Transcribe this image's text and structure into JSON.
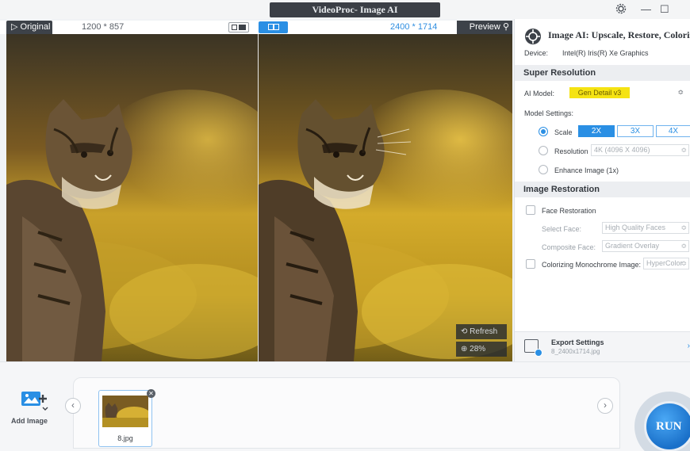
{
  "window": {
    "title": "VideoProc- Image AI",
    "settings_icon": "gear-icon",
    "minimize": "—",
    "maximize": "☐"
  },
  "preview_header": {
    "original_tab": "▷ Original",
    "original_resolution": "1200 * 857",
    "output_resolution": "2400 * 1714",
    "preview_tab": "Preview",
    "refresh_label": "Refresh",
    "zoom_label": "28%"
  },
  "panel": {
    "title": "Image AI: Upscale, Restore, Colorize",
    "device_label": "Device:",
    "device_value": "Intel(R) Iris(R) Xe Graphics",
    "super_resolution": {
      "heading": "Super Resolution",
      "ai_model_label": "AI Model:",
      "ai_model_value": "Gen Detail v3",
      "model_settings_label": "Model Settings:",
      "scale_label": "Scale",
      "scale_options": [
        "2X",
        "3X",
        "4X"
      ],
      "scale_selected": "2X",
      "resolution_label": "Resolution",
      "resolution_value": "4K (4096 X 4096)",
      "enhance_label": "Enhance Image (1x)"
    },
    "image_restoration": {
      "heading": "Image Restoration",
      "face_restoration_label": "Face Restoration",
      "select_face_label": "Select Face:",
      "select_face_value": "High Quality Faces",
      "composite_face_label": "Composite Face:",
      "composite_face_value": "Gradient Overlay",
      "colorize_label": "Colorizing Monochrome Image:",
      "colorize_value": "HyperColor"
    },
    "export": {
      "title": "Export Settings",
      "filename": "8_2400x1714.jpg"
    }
  },
  "bottom": {
    "add_image_label": "Add Image",
    "thumbnail_name": "8.jpg",
    "run_label": "RUN"
  },
  "colors": {
    "accent": "#2a8fe4",
    "dark_chrome": "#3d4249",
    "highlight": "#f5e313"
  }
}
